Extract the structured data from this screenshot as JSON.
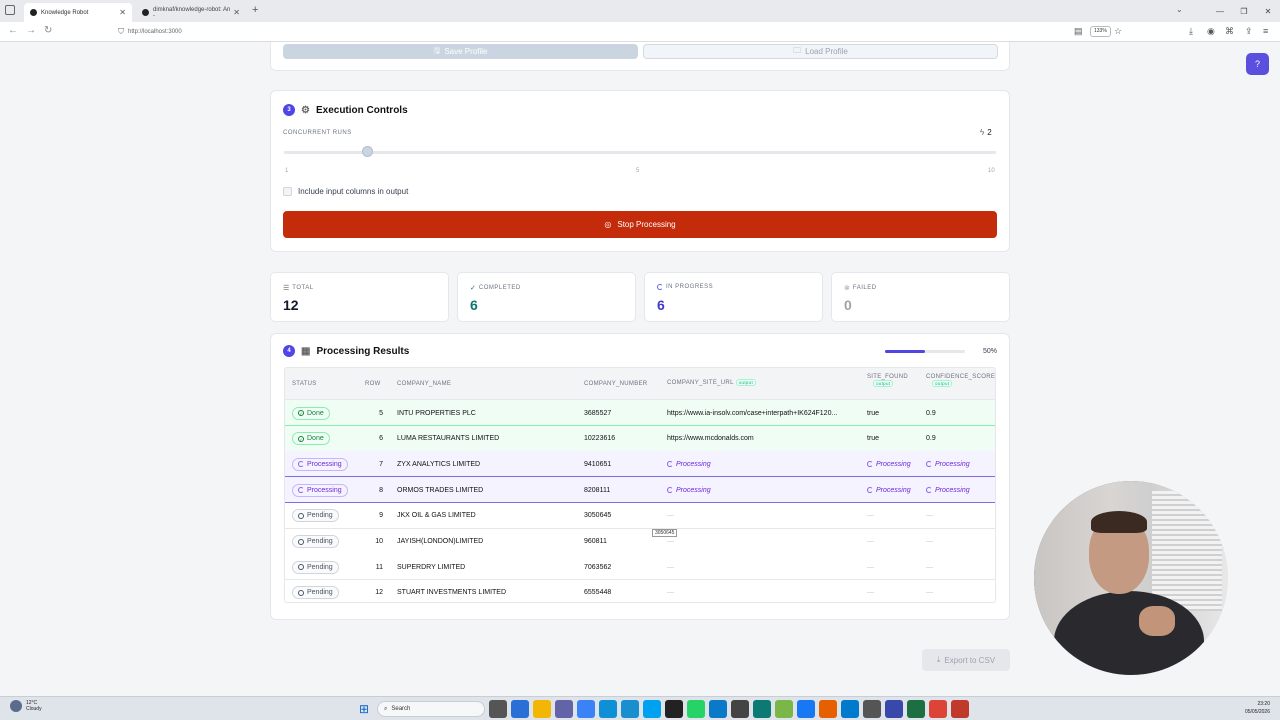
{
  "browser": {
    "tabs": [
      {
        "title": "Knowledge Robot",
        "active": true
      },
      {
        "title": "dimknaf/knowledge-robot: An -",
        "active": false
      }
    ],
    "url": "http://localhost:3000",
    "zoom": "133%"
  },
  "profile_buttons": {
    "save_label": "Save Profile",
    "load_label": "Load Profile"
  },
  "execution": {
    "step": "3",
    "title": "Execution Controls",
    "concurrent_label": "CONCURRENT RUNS",
    "concurrent_value": "2",
    "concurrent_fraction": 0.11,
    "ticks": [
      "1",
      "5",
      "10"
    ],
    "include_input_label": "Include input columns in output",
    "stop_label": "Stop Processing"
  },
  "stats": [
    {
      "label": "TOTAL",
      "value": "12",
      "color": "#111827",
      "icon": "list-icon"
    },
    {
      "label": "COMPLETED",
      "value": "6",
      "color": "#0f766e",
      "icon": "check-circle-icon"
    },
    {
      "label": "IN PROGRESS",
      "value": "6",
      "color": "#4338ca",
      "icon": "spinner-icon"
    },
    {
      "label": "FAILED",
      "value": "0",
      "color": "#9ca3af",
      "icon": "x-circle-icon"
    }
  ],
  "results": {
    "step": "4",
    "title": "Processing Results",
    "progress_percent": "50%",
    "progress_fraction": 0.5,
    "columns": [
      "STATUS",
      "ROW",
      "COMPANY_NAME",
      "COMPANY_NUMBER",
      "COMPANY_SITE_URL",
      "SITE_FOUND",
      "CONFIDENCE_SCORE"
    ],
    "output_badge": "output",
    "rows": [
      {
        "status": "Done",
        "row": "5",
        "name": "INTU PROPERTIES PLC",
        "number": "3685527",
        "url": "https://www.ia-insolv.com/case+interpath+IK624F120...",
        "found": "true",
        "score": "0.9"
      },
      {
        "status": "Done",
        "row": "6",
        "name": "LUMA RESTAURANTS LIMITED",
        "number": "10223616",
        "url": "https://www.mcdonalds.com",
        "found": "true",
        "score": "0.9"
      },
      {
        "status": "Processing",
        "row": "7",
        "name": "ZYX ANALYTICS LIMITED",
        "number": "9410651",
        "url": "Processing",
        "found": "Processing",
        "score": "Processing"
      },
      {
        "status": "Processing",
        "row": "8",
        "name": "ORMOS TRADES LIMITED",
        "number": "8208111",
        "url": "Processing",
        "found": "Processing",
        "score": "Processing"
      },
      {
        "status": "Pending",
        "row": "9",
        "name": "JKX OIL & GAS LIMITED",
        "number": "3050645",
        "url": "—",
        "found": "—",
        "score": "—"
      },
      {
        "status": "Pending",
        "row": "10",
        "name": "JAYISH(LONDON)LIMITED",
        "number": "960811",
        "url": "—",
        "found": "—",
        "score": "—"
      },
      {
        "status": "Pending",
        "row": "11",
        "name": "SUPERDRY LIMITED",
        "number": "7063562",
        "url": "—",
        "found": "—",
        "score": "—"
      },
      {
        "status": "Pending",
        "row": "12",
        "name": "STUART INVESTMENTS LIMITED",
        "number": "6555448",
        "url": "—",
        "found": "—",
        "score": "—"
      }
    ],
    "tooltip": "3050645"
  },
  "export_label": "Export to CSV",
  "taskbar": {
    "weather_temp": "12°C",
    "weather_text": "Cloudy",
    "search_placeholder": "Search",
    "time": "23:20",
    "date": "05/05/2026"
  }
}
